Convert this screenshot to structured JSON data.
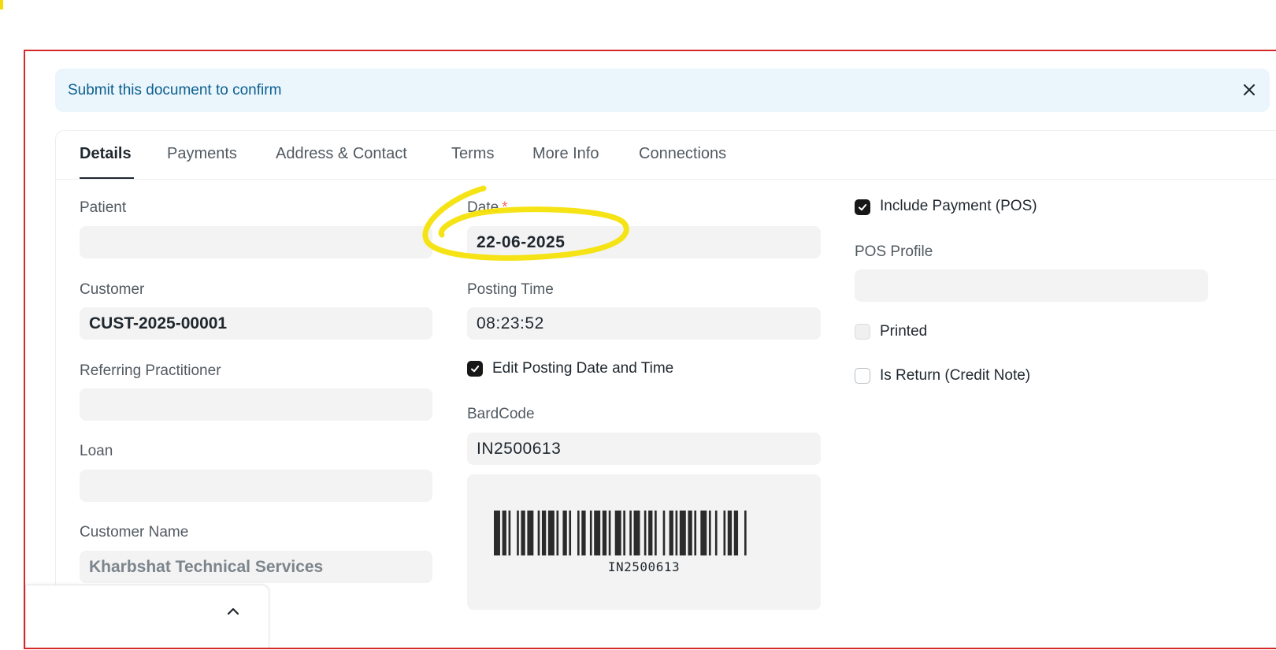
{
  "alert": {
    "message": "Submit this document to confirm",
    "close_icon": "close-icon"
  },
  "tabs": [
    {
      "label": "Details",
      "active": true
    },
    {
      "label": "Payments",
      "active": false
    },
    {
      "label": "Address & Contact",
      "active": false
    },
    {
      "label": "Terms",
      "active": false
    },
    {
      "label": "More Info",
      "active": false
    },
    {
      "label": "Connections",
      "active": false
    }
  ],
  "left_column": {
    "patient": {
      "label": "Patient",
      "value": ""
    },
    "customer": {
      "label": "Customer",
      "value": "CUST-2025-00001"
    },
    "referring_practitioner": {
      "label": "Referring Practitioner",
      "value": ""
    },
    "loan": {
      "label": "Loan",
      "value": ""
    },
    "customer_name": {
      "label": "Customer Name",
      "value": "Kharbshat Technical Services"
    }
  },
  "middle_column": {
    "date": {
      "label": "Date",
      "required_mark": "*",
      "value": "22-06-2025"
    },
    "posting_time": {
      "label": "Posting Time",
      "value": "08:23:52"
    },
    "edit_posting": {
      "label": "Edit Posting Date and Time",
      "checked": true
    },
    "barcode": {
      "label": "BardCode",
      "value": "IN2500613",
      "caption": "IN2500613"
    }
  },
  "right_column": {
    "include_payment": {
      "label": "Include Payment (POS)",
      "checked": true
    },
    "pos_profile": {
      "label": "POS Profile",
      "value": ""
    },
    "printed": {
      "label": "Printed",
      "checked": false,
      "disabled": true
    },
    "is_return": {
      "label": "Is Return (Credit Note)",
      "checked": false
    }
  },
  "footer": {
    "icon": "chevron-up-icon"
  },
  "colors": {
    "alert_bg": "#ebf5fc",
    "alert_text": "#0b5f8f",
    "frame_border": "#d62828",
    "highlight": "#f5e10a",
    "required": "#f56b54"
  }
}
